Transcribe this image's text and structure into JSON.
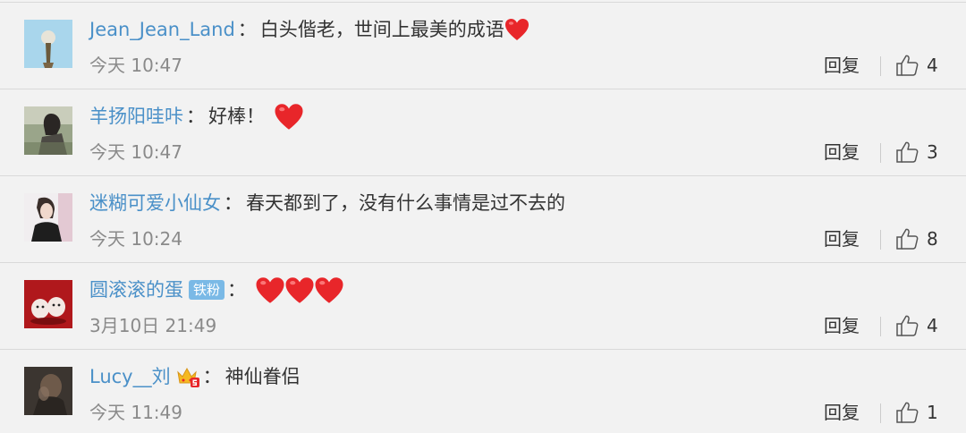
{
  "icons": {
    "like": "thumbs-up-icon",
    "heart": "red-heart-emoji-icon",
    "fan_badge": "fan-badge",
    "vip": "crown-vip-icon"
  },
  "colors": {
    "username": "#4a90c8",
    "text": "#333333",
    "time": "#8a8a8a",
    "separator": "#d9d9d9",
    "heart": "#e8262a",
    "badge": "#7ab9e6"
  },
  "comments": [
    {
      "username": "Jean_Jean_Land",
      "colon": "：",
      "text": "白头偕老，世间上最美的成语",
      "hearts_after_text": 1,
      "time": "今天 10:47",
      "reply_label": "回复",
      "likes": "4"
    },
    {
      "username": "羊扬阳哇咔",
      "colon": "：",
      "text": "好棒！",
      "hearts_after_text": 1,
      "time": "今天 10:47",
      "reply_label": "回复",
      "likes": "3"
    },
    {
      "username": "迷糊可爱小仙女",
      "colon": "：",
      "text": "春天都到了，没有什么事情是过不去的",
      "hearts_after_text": 0,
      "time": "今天 10:24",
      "reply_label": "回复",
      "likes": "8"
    },
    {
      "username": "圆滚滚的蛋",
      "badge": "铁粉",
      "colon": "：",
      "text": "",
      "hearts_after_text": 3,
      "time": "3月10日 21:49",
      "reply_label": "回复",
      "likes": "4"
    },
    {
      "username": "Lucy__刘",
      "colon": "：",
      "text": "神仙眷侣",
      "hearts_after_text": 0,
      "time": "今天 11:49",
      "reply_label": "回复",
      "likes": "1"
    }
  ]
}
